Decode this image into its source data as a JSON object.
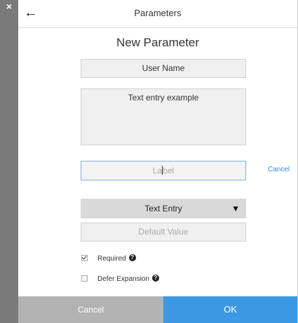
{
  "close_icon": "close-icon",
  "header": {
    "back_icon": "arrow-left-icon",
    "title": "Parameters"
  },
  "page_title": "New Parameter",
  "form": {
    "name_value": "User Name",
    "description_value": "Text entry example",
    "label_placeholder": "Label",
    "label_cancel": "Cancel",
    "type_select": {
      "selected": "Text Entry",
      "arrow_icon": "dropdown-triangle-icon"
    },
    "default_value_placeholder": "Default Value",
    "required": {
      "label": "Required",
      "checked": true,
      "help_icon": "question-circle-icon"
    },
    "defer_expansion": {
      "label": "Defer Expansion",
      "checked": false,
      "help_icon": "question-circle-icon"
    }
  },
  "footer": {
    "cancel_label": "Cancel",
    "ok_label": "OK"
  },
  "colors": {
    "accent": "#3d98e3",
    "cancel_button": "#b3b3b3",
    "link": "#3b8ad8",
    "side_strip": "#7a7a7a"
  }
}
